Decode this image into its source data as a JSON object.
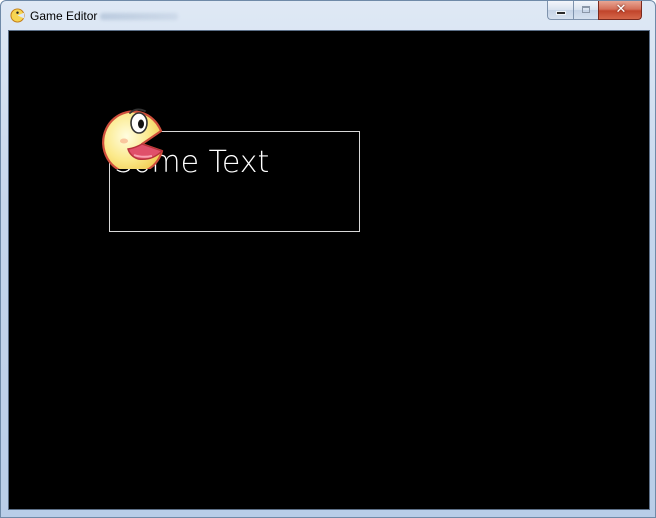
{
  "window": {
    "title": "Game Editor",
    "icon": "pacman-icon",
    "controls": {
      "minimize": "minimize-icon",
      "maximize": "maximize-icon",
      "close_glyph": "✕"
    }
  },
  "canvas": {
    "background": "#000000",
    "text_actor": {
      "text": "Some Text",
      "color": "#ffffff",
      "border_color": "#d8d8d8"
    },
    "sprite": {
      "icon": "pacman-sprite-icon",
      "body_color": "#fbe98a",
      "outline_color": "#cf4f3c"
    }
  }
}
